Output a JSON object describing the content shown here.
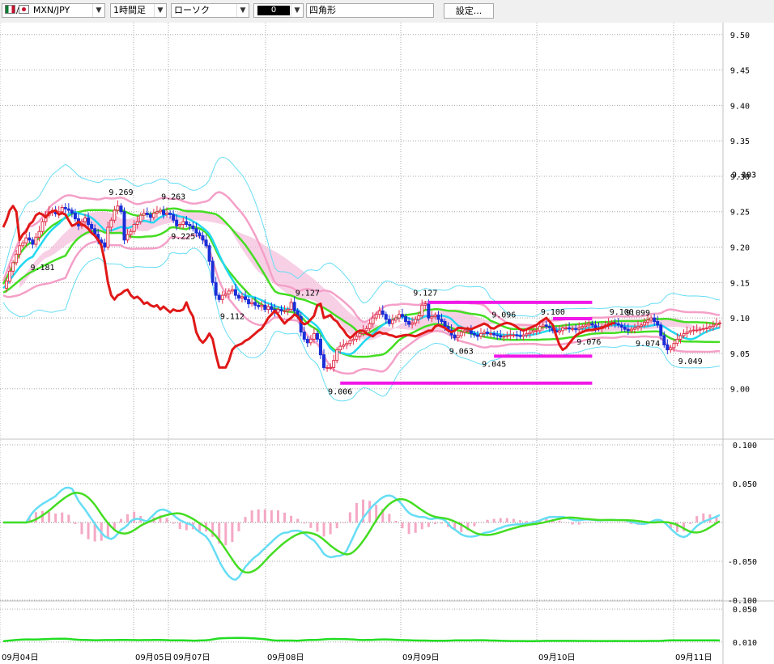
{
  "toolbar": {
    "pair": "MXN/JPY",
    "timeframe": "1時間足",
    "chart_style": "ローソク",
    "color_label": "0",
    "drawing_tool": "四角形",
    "settings_label": "設定..."
  },
  "chart_data": [
    {
      "type": "candlestick",
      "title": "MXN/JPY",
      "ylim": [
        8.97,
        9.51
      ],
      "y_ticks": [
        "9.50",
        "9.45",
        "9.40",
        "9.35",
        "9.30",
        "9.25",
        "9.20",
        "9.15",
        "9.10",
        "9.05",
        "9.00"
      ],
      "current_price_labels": [
        "9.103",
        "9.093"
      ],
      "x_ticks": [
        "09月04日",
        "09月05日",
        "09月07日",
        "09月08日",
        "09月09日",
        "09月10日",
        "09月11日"
      ],
      "high_low_labels": [
        {
          "text": "9.181",
          "kind": "low",
          "x": 12,
          "y": 9.181
        },
        {
          "text": "9.269",
          "kind": "high",
          "x": 36,
          "y": 9.269
        },
        {
          "text": "9.263",
          "kind": "high",
          "x": 52,
          "y": 9.263
        },
        {
          "text": "9.225",
          "kind": "low",
          "x": 55,
          "y": 9.225
        },
        {
          "text": "9.112",
          "kind": "low",
          "x": 70,
          "y": 9.112
        },
        {
          "text": "9.127",
          "kind": "high",
          "x": 93,
          "y": 9.127
        },
        {
          "text": "9.006",
          "kind": "low",
          "x": 103,
          "y": 9.006
        },
        {
          "text": "9.127",
          "kind": "high",
          "x": 129,
          "y": 9.127
        },
        {
          "text": "9.063",
          "kind": "low",
          "x": 140,
          "y": 9.063
        },
        {
          "text": "9.096",
          "kind": "high",
          "x": 153,
          "y": 9.096
        },
        {
          "text": "9.045",
          "kind": "low",
          "x": 150,
          "y": 9.045
        },
        {
          "text": "9.100",
          "kind": "high",
          "x": 168,
          "y": 9.1
        },
        {
          "text": "9.076",
          "kind": "low",
          "x": 179,
          "y": 9.076
        },
        {
          "text": "9.100",
          "kind": "high",
          "x": 189,
          "y": 9.1
        },
        {
          "text": "9.099",
          "kind": "high",
          "x": 194,
          "y": 9.099
        },
        {
          "text": "9.074",
          "kind": "low",
          "x": 197,
          "y": 9.074
        },
        {
          "text": "9.049",
          "kind": "low",
          "x": 210,
          "y": 9.049
        }
      ],
      "rectangles": [
        {
          "x_start": 103,
          "x_end": 180,
          "y": 9.008
        },
        {
          "x_start": 130,
          "x_end": 180,
          "y": 9.122
        },
        {
          "x_start": 150,
          "x_end": 180,
          "y": 9.046
        },
        {
          "x_start": 168,
          "x_end": 180,
          "y": 9.099
        }
      ],
      "colors": {
        "up": "#e0304a",
        "down": "#1a2fd8",
        "ma_short": "#44dd22",
        "bollinger_outer": "#66ddf4",
        "bollinger_inner": "#f4a0c8",
        "center": "#22d8f0",
        "lag_line": "#e01818",
        "rectangle": "#f018e8",
        "cloud": "#f6c0dc"
      },
      "close_series": [
        9.142,
        9.152,
        9.166,
        9.178,
        9.19,
        9.202,
        9.206,
        9.213,
        9.21,
        9.204,
        9.214,
        9.222,
        9.236,
        9.245,
        9.25,
        9.252,
        9.247,
        9.25,
        9.256,
        9.254,
        9.252,
        9.248,
        9.24,
        9.23,
        9.236,
        9.241,
        9.232,
        9.226,
        9.218,
        9.21,
        9.206,
        9.2,
        9.228,
        9.238,
        9.252,
        9.258,
        9.25,
        9.21,
        9.218,
        9.222,
        9.232,
        9.236,
        9.245,
        9.248,
        9.246,
        9.242,
        9.248,
        9.25,
        9.252,
        9.246,
        9.248,
        9.246,
        9.238,
        9.23,
        9.232,
        9.236,
        9.232,
        9.23,
        9.226,
        9.22,
        9.216,
        9.21,
        9.202,
        9.18,
        9.15,
        9.132,
        9.126,
        9.132,
        9.134,
        9.138,
        9.14,
        9.132,
        9.128,
        9.13,
        9.126,
        9.12,
        9.122,
        9.118,
        9.116,
        9.118,
        9.112,
        9.116,
        9.112,
        9.108,
        9.112,
        9.11,
        9.11,
        9.112,
        9.122,
        9.11,
        9.102,
        9.08,
        9.07,
        9.065,
        9.07,
        9.078,
        9.07,
        9.048,
        9.03,
        9.03,
        9.03,
        9.04,
        9.055,
        9.06,
        9.062,
        9.064,
        9.068,
        9.07,
        9.074,
        9.078,
        9.082,
        9.085,
        9.092,
        9.1,
        9.105,
        9.11,
        9.105,
        9.098,
        9.092,
        9.097,
        9.1,
        9.105,
        9.102,
        9.095,
        9.091,
        9.093,
        9.098,
        9.103,
        9.118,
        9.12,
        9.1,
        9.102,
        9.104,
        9.098,
        9.095,
        9.088,
        9.083,
        9.076,
        9.072,
        9.075,
        9.08,
        9.082,
        9.082,
        9.078,
        9.076,
        9.074,
        9.078,
        9.08,
        9.078,
        9.078,
        9.076,
        9.075,
        9.073,
        9.074,
        9.075,
        9.076,
        9.076,
        9.075,
        9.074,
        9.076,
        9.078,
        9.08,
        9.082,
        9.082,
        9.088,
        9.09,
        9.088,
        9.086,
        9.082,
        9.08,
        9.082,
        9.086,
        9.086,
        9.085,
        9.085,
        9.084,
        9.086,
        9.088,
        9.09,
        9.092,
        9.09,
        9.086,
        9.085,
        9.088,
        9.09,
        9.092,
        9.093,
        9.092,
        9.09,
        9.087,
        9.084,
        9.082,
        9.084,
        9.086,
        9.088,
        9.09,
        9.094,
        9.097,
        9.1,
        9.095,
        9.09,
        9.075,
        9.062,
        9.055,
        9.058,
        9.064,
        9.07,
        9.075,
        9.078,
        9.08,
        9.082,
        9.083,
        9.083,
        9.084,
        9.085,
        9.086,
        9.088,
        9.09,
        9.092,
        9.093
      ]
    },
    {
      "type": "bar+line",
      "title": "MACD",
      "ylim": [
        -0.1,
        0.1
      ],
      "y_ticks": [
        "0.100",
        "0.050",
        "-0.050",
        "-0.100"
      ],
      "colors": {
        "histogram": "#f4a8c4",
        "macd": "#66ddf4",
        "signal": "#44dd22"
      }
    },
    {
      "type": "line",
      "title": "",
      "ylim": [
        0.005,
        0.055
      ],
      "y_ticks": [
        "0.050",
        "0.010"
      ],
      "colors": {
        "line": "#22dd22"
      }
    }
  ]
}
